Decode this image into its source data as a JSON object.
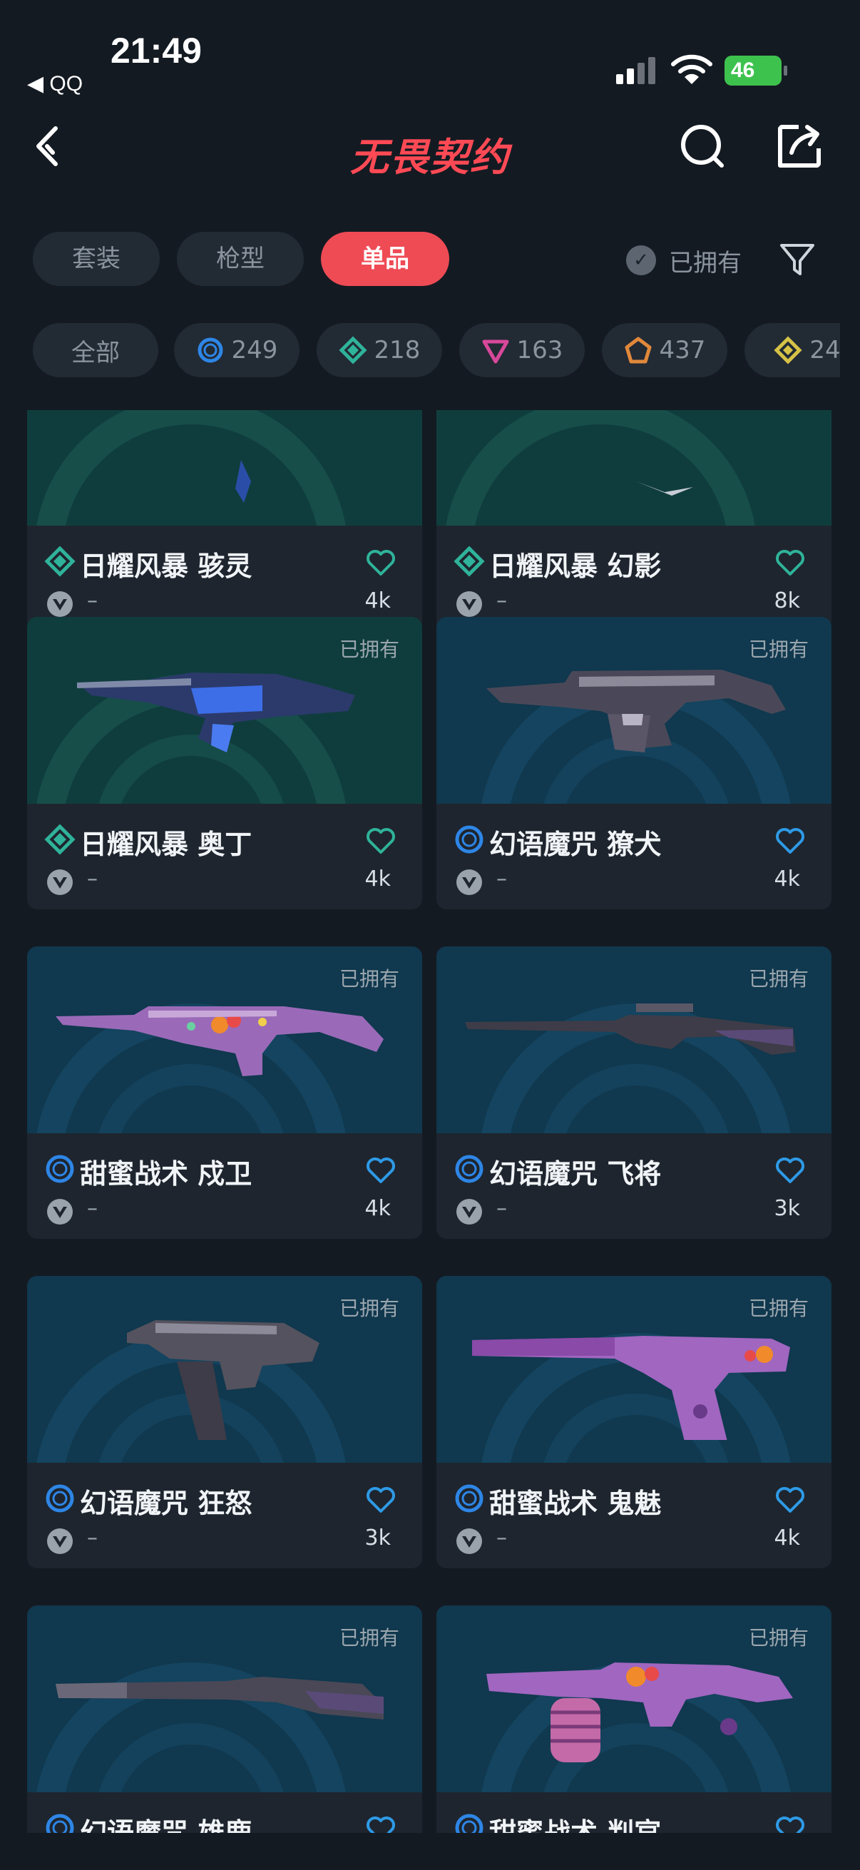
{
  "status": {
    "time": "21:49",
    "back_app": "◀ QQ",
    "battery": "46"
  },
  "header": {
    "logo": "无畏契约"
  },
  "tabs": [
    {
      "label": "套装",
      "active": false
    },
    {
      "label": "枪型",
      "active": false
    },
    {
      "label": "单品",
      "active": true
    }
  ],
  "owned_toggle": {
    "label": "已拥有"
  },
  "chips": [
    {
      "label": "全部"
    },
    {
      "label": "249",
      "color": "#2e86e6"
    },
    {
      "label": "218",
      "color": "#2fb39a"
    },
    {
      "label": "163",
      "color": "#d8489a"
    },
    {
      "label": "437",
      "color": "#e0883a"
    },
    {
      "label": "24",
      "color": "#d6c246"
    }
  ],
  "cards": [
    {
      "title": "日耀风暴 骇灵",
      "count": "4k",
      "owned_label": "",
      "rarity": "teal",
      "dash": "–"
    },
    {
      "title": "日耀风暴 幻影",
      "count": "8k",
      "owned_label": "",
      "rarity": "teal",
      "dash": "–"
    },
    {
      "title": "日耀风暴 奥丁",
      "count": "4k",
      "owned_label": "已拥有",
      "rarity": "teal",
      "dash": "–"
    },
    {
      "title": "幻语魔咒 獠犬",
      "count": "4k",
      "owned_label": "已拥有",
      "rarity": "blue",
      "dash": "–"
    },
    {
      "title": "甜蜜战术 戍卫",
      "count": "4k",
      "owned_label": "已拥有",
      "rarity": "blue",
      "dash": "–"
    },
    {
      "title": "幻语魔咒 飞将",
      "count": "3k",
      "owned_label": "已拥有",
      "rarity": "blue",
      "dash": "–"
    },
    {
      "title": "幻语魔咒 狂怒",
      "count": "3k",
      "owned_label": "已拥有",
      "rarity": "blue",
      "dash": "–"
    },
    {
      "title": "甜蜜战术 鬼魅",
      "count": "4k",
      "owned_label": "已拥有",
      "rarity": "blue",
      "dash": "–"
    },
    {
      "title": "幻语魔咒 雄鹿",
      "count": "",
      "owned_label": "已拥有",
      "rarity": "blue",
      "dash": ""
    },
    {
      "title": "甜蜜战术 判官",
      "count": "",
      "owned_label": "已拥有",
      "rarity": "blue",
      "dash": ""
    }
  ],
  "colors": {
    "accent": "#ef4b55",
    "teal_rarity": "#2fb39a",
    "blue_rarity": "#2e86e6"
  }
}
